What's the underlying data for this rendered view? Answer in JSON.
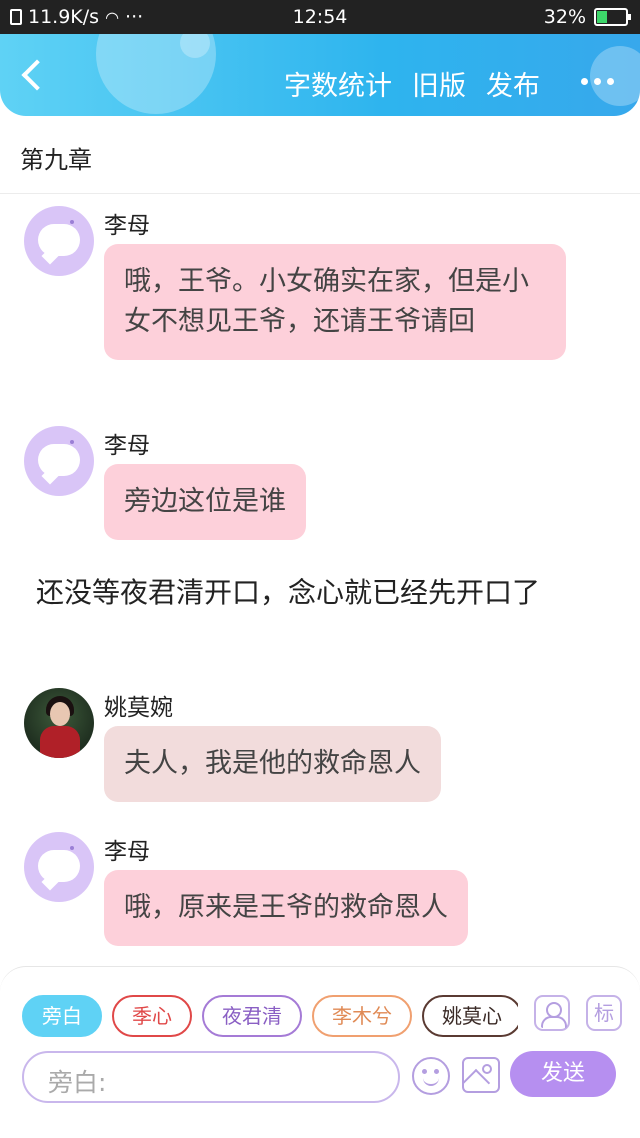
{
  "status_bar": {
    "network_speed": "11.9K/s",
    "dots": "···",
    "time": "12:54",
    "battery": "32%",
    "battery_level": 0.32
  },
  "header": {
    "actions": [
      "字数统计",
      "旧版",
      "发布"
    ]
  },
  "chapter_title": "第九章",
  "messages": [
    {
      "sender": "李母",
      "text": "哦，王爷。小女确实在家，但是小女不想见王爷，还请王爷请回",
      "style": "pink"
    },
    {
      "sender": "李母",
      "text": "旁边这位是谁",
      "style": "pink"
    },
    {
      "sender": "姚莫婉",
      "text": "夫人，我是他的救命恩人",
      "style": "beige"
    },
    {
      "sender": "李母",
      "text": "哦，原来是王爷的救命恩人",
      "style": "pink"
    }
  ],
  "narration": "还没等夜君清开口，念心就已经先开口了",
  "composer": {
    "characters": [
      "旁白",
      "季心",
      "夜君清",
      "李木兮",
      "姚莫心"
    ],
    "active_character": "旁白",
    "tag_label": "标",
    "input_placeholder": "旁白:",
    "send_label": "发送"
  }
}
